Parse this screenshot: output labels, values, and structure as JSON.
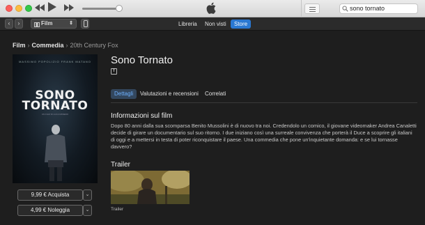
{
  "window": {
    "search_value": "sono tornato"
  },
  "navbar": {
    "media_select": "Film",
    "tabs": [
      {
        "label": "Libreria"
      },
      {
        "label": "Non visti"
      },
      {
        "label": "Store"
      }
    ],
    "active_tab": "Store"
  },
  "breadcrumb": {
    "items": [
      "Film",
      "Commedia",
      "20th Century Fox"
    ]
  },
  "poster": {
    "actors_line": "MASSIMO POPOLIZIO      FRANK MATANO",
    "title_line1": "SONO",
    "title_line2": "TORNATO",
    "subtitle": "UN FILM DI LUCA MINIERO"
  },
  "movie": {
    "title": "Sono Tornato",
    "rating_badge": "T",
    "buy_label": "9,99 € Acquista",
    "rent_label": "4,99 € Noleggia"
  },
  "content_tabs": [
    {
      "label": "Dettagli"
    },
    {
      "label": "Valutazioni e recensioni"
    },
    {
      "label": "Correlati"
    }
  ],
  "info": {
    "heading": "Informazioni sul film",
    "body": "Dopo 80 anni dalla sua scomparsa Benito Mussolini è di nuovo tra noi. Credendolo un comico, il giovane videomaker Andrea Canaletti decide di girare un documentario sul suo ritorno. I due iniziano così una surreale convivenza che porterà il Duce a scoprire gli italiani di oggi e a mettersi in testa di poter riconquistare il paese. Una commedia che pone un'inquietante domanda: e se lui tornasse davvero?"
  },
  "trailer": {
    "heading": "Trailer",
    "caption": "Trailer"
  },
  "colors": {
    "accent": "#2a78d2",
    "background": "#1e1e1e",
    "active_tab_text": "#6eb1ff"
  }
}
